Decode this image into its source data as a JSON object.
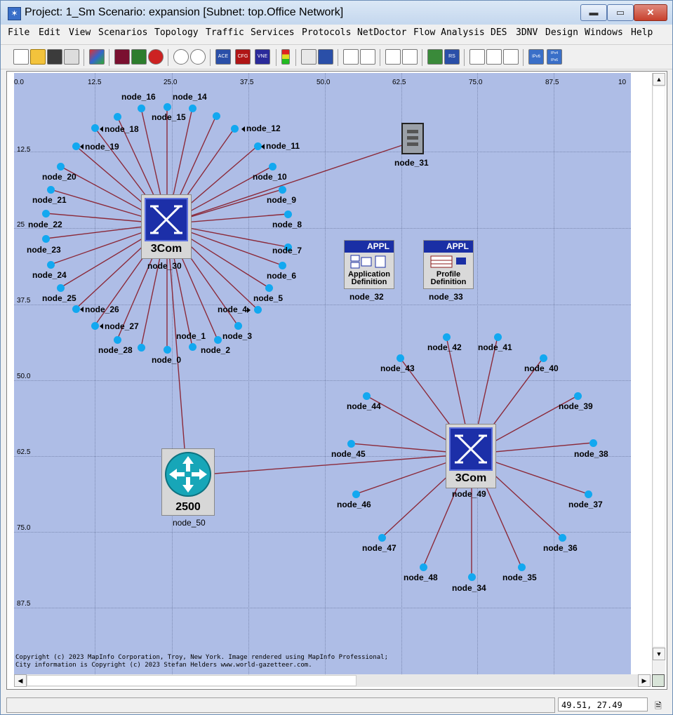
{
  "window": {
    "title": "Project: 1_Sm Scenario: expansion  [Subnet: top.Office Network]",
    "app_icon": "project-star-icon",
    "controls": {
      "minimize": "▬",
      "maximize": "▭",
      "close": "✕"
    }
  },
  "menu": [
    "File",
    "Edit",
    "View",
    "Scenarios",
    "Topology",
    "Traffic",
    "Services",
    "Protocols",
    "NetDoctor",
    "Flow Analysis",
    "DES",
    "3DNV",
    "Design",
    "Windows",
    "Help"
  ],
  "toolbar": {
    "icons": [
      "new-project-icon",
      "open-folder-icon",
      "save-icon",
      "print-icon",
      "object-palette-icon",
      "fail-link-icon",
      "recover-link-icon",
      "verify-links-icon",
      "zoom-in-icon",
      "zoom-out-icon",
      "import-ace-icon",
      "import-cfg-icon",
      "import-vne-icon",
      "traffic-icon",
      "configure-run-icon",
      "view-results-icon",
      "topology-layout-icon",
      "topology-select-icon",
      "link-wizard-icon",
      "path-icon",
      "mesh-icon",
      "rsvp-icon",
      "checklist-icon",
      "chart-icon",
      "bar-chart-icon",
      "ipv6-icon",
      "ipv4-ipv6-icon"
    ],
    "labels": {
      "ace": "ACE",
      "cfg": "CFG",
      "vne": "VNE",
      "rs": "RS",
      "ipv6": "IPv6",
      "ipv4v6": "IPv4 IPv6"
    }
  },
  "ruler": {
    "x_ticks": [
      "0.0",
      "12.5",
      "25.0",
      "37.5",
      "50.0",
      "62.5",
      "75.0",
      "87.5",
      "10"
    ],
    "y_ticks": [
      "12.5",
      "25",
      "37.5",
      "50.0",
      "62.5",
      "75.0",
      "87.5"
    ]
  },
  "devices": {
    "switch_a": {
      "name": "node_30",
      "brand": "3Com",
      "icon": "switch-icon"
    },
    "switch_b": {
      "name": "node_49",
      "brand": "3Com",
      "icon": "switch-icon"
    },
    "router": {
      "name": "node_50",
      "model": "2500",
      "icon": "router-icon"
    },
    "server": {
      "name": "node_31",
      "icon": "server-icon"
    },
    "app_def": {
      "name": "node_32",
      "header": "APPL",
      "caption_1": "Application",
      "caption_2": "Definition",
      "icon": "application-config-icon"
    },
    "profile_def": {
      "name": "node_33",
      "header": "APPL",
      "caption_1": "Profile",
      "caption_2": "Definition",
      "icon": "profile-config-icon"
    }
  },
  "clients_a": [
    "node_0",
    "node_1",
    "node_2",
    "node_3",
    "node_4",
    "node_5",
    "node_6",
    "node_7",
    "node_8",
    "node_9",
    "node_10",
    "node_11",
    "node_12",
    "node_14",
    "node_15",
    "node_16",
    "node_18",
    "node_19",
    "node_20",
    "node_21",
    "node_22",
    "node_23",
    "node_24",
    "node_25",
    "node_26",
    "node_27",
    "node_28"
  ],
  "clients_b": [
    "node_34",
    "node_35",
    "node_36",
    "node_37",
    "node_38",
    "node_39",
    "node_40",
    "node_41",
    "node_42",
    "node_43",
    "node_44",
    "node_45",
    "node_46",
    "node_47",
    "node_48"
  ],
  "copyright": {
    "line1": "Copyright (c) 2023 MapInfo Corporation, Troy, New York. Image rendered using MapInfo Professional;",
    "line2": "City information is Copyright (c) 2023 Stefan Helders www.world-gazetteer.com."
  },
  "scrollbars": {
    "up": "▲",
    "down": "▼",
    "left": "◀",
    "right": "▶"
  },
  "status": {
    "coords": "49.51, 27.49",
    "icon": "status-document-icon"
  },
  "colors": {
    "canvas": "#aebde6",
    "link": "#8b2a3a",
    "node": "#12a8f0",
    "switch_face": "#1c2fa8",
    "router": "#17a6b8",
    "appl_header": "#1a2fa5"
  }
}
